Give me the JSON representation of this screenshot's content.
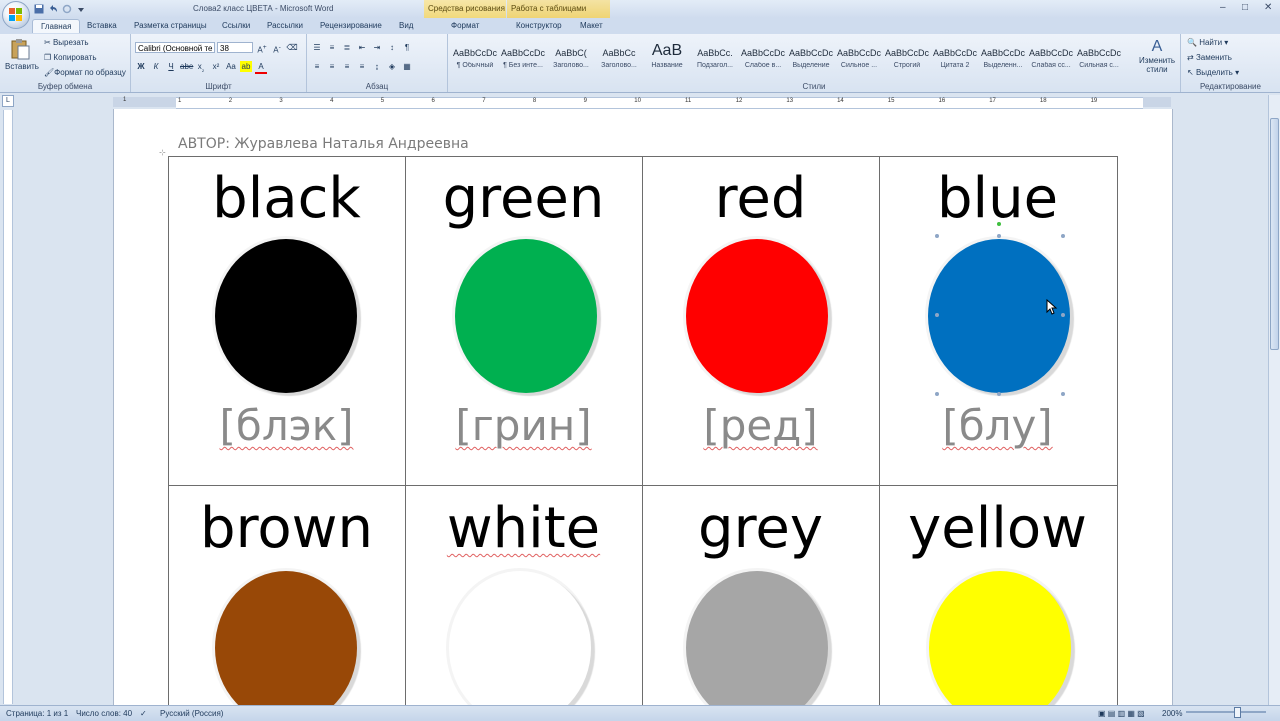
{
  "window": {
    "title": "Слова2 класс ЦВЕТА - Microsoft Word",
    "context_tools_drawing": "Средства рисования",
    "context_tools_table": "Работа с таблицами"
  },
  "tabs": [
    {
      "label": "Главная"
    },
    {
      "label": "Вставка"
    },
    {
      "label": "Разметка страницы"
    },
    {
      "label": "Ссылки"
    },
    {
      "label": "Рассылки"
    },
    {
      "label": "Рецензирование"
    },
    {
      "label": "Вид"
    },
    {
      "label": "Формат"
    },
    {
      "label": "Конструктор"
    },
    {
      "label": "Макет"
    }
  ],
  "ribbon": {
    "clipboard": {
      "paste": "Вставить",
      "cut": "Вырезать",
      "copy": "Копировать",
      "format_painter": "Формат по образцу",
      "label": "Буфер обмена"
    },
    "font": {
      "font_name": "Calibri (Основной те",
      "font_size": "38",
      "label": "Шрифт"
    },
    "paragraph": {
      "label": "Абзац"
    },
    "styles": {
      "label": "Стили",
      "items": [
        {
          "preview": "AaBbCcDc",
          "name": "¶ Обычный"
        },
        {
          "preview": "AaBbCcDc",
          "name": "¶ Без инте..."
        },
        {
          "preview": "AaBbC(",
          "name": "Заголово..."
        },
        {
          "preview": "AaBbCc",
          "name": "Заголово..."
        },
        {
          "preview": "AaB",
          "name": "Название"
        },
        {
          "preview": "AaBbCc.",
          "name": "Подзагол..."
        },
        {
          "preview": "AaBbCcDc",
          "name": "Слабое в..."
        },
        {
          "preview": "AaBbCcDc",
          "name": "Выделение"
        },
        {
          "preview": "AaBbCcDc",
          "name": "Сильное ..."
        },
        {
          "preview": "AaBbCcDc",
          "name": "Строгий"
        },
        {
          "preview": "AaBbCcDc",
          "name": "Цитата 2"
        },
        {
          "preview": "AaBbCcDc",
          "name": "Выделенн..."
        },
        {
          "preview": "AaBbCcDc",
          "name": "Слабая сс..."
        },
        {
          "preview": "AaBbCcDc",
          "name": "Сильная с..."
        }
      ],
      "change_styles": "Изменить стили"
    },
    "editing": {
      "find": "Найти",
      "replace": "Заменить",
      "select": "Выделить",
      "label": "Редактирование"
    }
  },
  "ruler": {
    "numbers": [
      "1",
      "1",
      "2",
      "3",
      "4",
      "5",
      "6",
      "7",
      "8",
      "9",
      "10",
      "11",
      "12",
      "13",
      "14",
      "15",
      "16",
      "17",
      "18",
      "19"
    ]
  },
  "document": {
    "author": "АВТОР: Журавлева Наталья Андреевна",
    "colors": [
      {
        "word": "black",
        "transcription": "[блэк]",
        "hex": "#000000"
      },
      {
        "word": "green",
        "transcription": "[грин]",
        "hex": "#00b050"
      },
      {
        "word": "red",
        "transcription": "[ред]",
        "hex": "#ff0000"
      },
      {
        "word": "blue",
        "transcription": "[блу]",
        "hex": "#0070c0"
      },
      {
        "word": "brown",
        "transcription": "",
        "hex": "#984807"
      },
      {
        "word": "white",
        "transcription": "",
        "hex": "#ffffff"
      },
      {
        "word": "grey",
        "transcription": "",
        "hex": "#a6a6a6"
      },
      {
        "word": "yellow",
        "transcription": "",
        "hex": "#ffff00"
      }
    ]
  },
  "statusbar": {
    "page": "Страница: 1 из 1",
    "words": "Число слов: 40",
    "language": "Русский (Россия)",
    "zoom": "200%"
  }
}
